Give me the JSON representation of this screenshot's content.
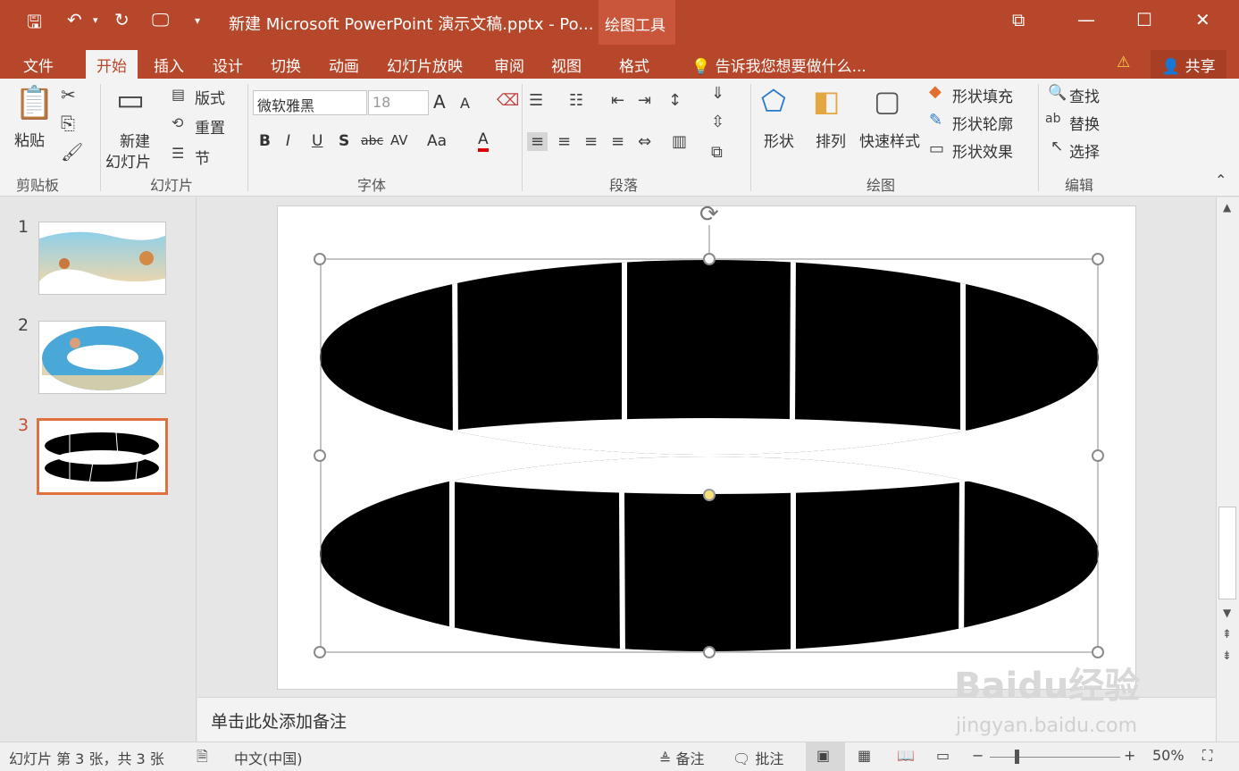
{
  "window": {
    "title": "新建 Microsoft PowerPoint 演示文稿.pptx - Po...",
    "context_tab_group": "绘图工具",
    "minimize": "—",
    "maximize": "☐",
    "close": "✕"
  },
  "tabs": [
    "文件",
    "开始",
    "插入",
    "设计",
    "切换",
    "动画",
    "幻灯片放映",
    "审阅",
    "视图",
    "格式"
  ],
  "active_tab": "开始",
  "tell_me": "告诉我您想要做什么...",
  "share": "共享",
  "ribbon": {
    "clipboard": {
      "paste": "粘贴",
      "label": "剪贴板"
    },
    "slides": {
      "new_slide_1": "新建",
      "new_slide_2": "幻灯片",
      "layout": "版式",
      "reset": "重置",
      "section": "节",
      "label": "幻灯片"
    },
    "font": {
      "name": "微软雅黑",
      "size": "18",
      "label": "字体",
      "bold": "B",
      "italic": "I",
      "underline": "U",
      "shadow": "S",
      "strike": "abc",
      "spacing": "AV",
      "case": "Aa",
      "color": "A",
      "grow": "A",
      "shrink": "A"
    },
    "paragraph": {
      "label": "段落"
    },
    "drawing": {
      "shapes": "形状",
      "arrange": "排列",
      "quick_styles": "快速样式",
      "fill": "形状填充",
      "outline": "形状轮廓",
      "effects": "形状效果",
      "label": "绘图"
    },
    "editing": {
      "find": "查找",
      "replace": "替换",
      "select": "选择",
      "label": "编辑"
    }
  },
  "slides": [
    {
      "number": "1"
    },
    {
      "number": "2"
    },
    {
      "number": "3",
      "selected": true
    }
  ],
  "notes_placeholder": "单击此处添加备注",
  "status": {
    "slide_info": "幻灯片 第 3 张，共 3 张",
    "language": "中文(中国)",
    "notes": "备注",
    "comments": "批注",
    "zoom": "50%"
  },
  "watermark": {
    "brand": "Baidu经验",
    "url": "jingyan.baidu.com"
  },
  "colors": {
    "accent": "#b7472a",
    "selected_thumb_border": "#e0703e"
  }
}
